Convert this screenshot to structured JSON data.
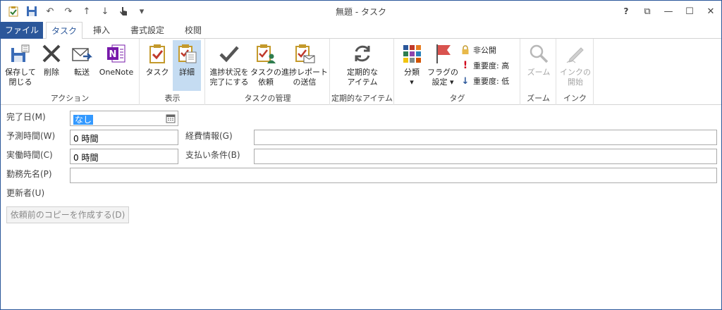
{
  "window": {
    "title": "無題 - タスク"
  },
  "qat": {
    "undo_arrow": "↶",
    "redo_arrow": "↷",
    "up": "↑",
    "down": "↓",
    "more": "▾"
  },
  "controls": {
    "help": "?",
    "restore_ribbon": "⧉",
    "minimize": "—",
    "maximize": "☐",
    "close": "✕"
  },
  "tabs": [
    {
      "label": "ファイル"
    },
    {
      "label": "タスク"
    },
    {
      "label": "挿入"
    },
    {
      "label": "書式設定"
    },
    {
      "label": "校閲"
    }
  ],
  "ribbon": {
    "actions": {
      "group_label": "アクション",
      "save_close_1": "保存して",
      "save_close_2": "閉じる",
      "delete": "削除",
      "forward": "転送",
      "onenote": "OneNote"
    },
    "show": {
      "group_label": "表示",
      "task": "タスク",
      "details": "詳細"
    },
    "manage": {
      "group_label": "タスクの管理",
      "complete_1": "進捗状況を",
      "complete_2": "完了にする",
      "assign_1": "タスクの",
      "assign_2": "依頼",
      "report_1": "進捗レポート",
      "report_2": "の送信"
    },
    "recurrence": {
      "group_label": "定期的なアイテム",
      "label_1": "定期的な",
      "label_2": "アイテム"
    },
    "tags": {
      "group_label": "タグ",
      "categorize": "分類",
      "flag_1": "フラグの",
      "flag_2": "設定",
      "private": "非公開",
      "high": "重要度: 高",
      "low": "重要度: 低"
    },
    "zoom": {
      "group_label": "ズーム",
      "label": "ズーム"
    },
    "ink": {
      "group_label": "インク",
      "label_1": "インクの",
      "label_2": "開始"
    }
  },
  "form": {
    "complete_date_label": "完了日(M)",
    "complete_date_value": "なし",
    "estimated_label": "予測時間(W)",
    "estimated_value": "0 時間",
    "actual_label": "実働時間(C)",
    "actual_value": "0 時間",
    "billing_label": "経費情報(G)",
    "billing_value": "",
    "payment_label": "支払い条件(B)",
    "payment_value": "",
    "company_label": "勤務先名(P)",
    "company_value": "",
    "updated_by_label": "更新者(U)",
    "copy_button": "依頼前のコピーを作成する(D)"
  }
}
